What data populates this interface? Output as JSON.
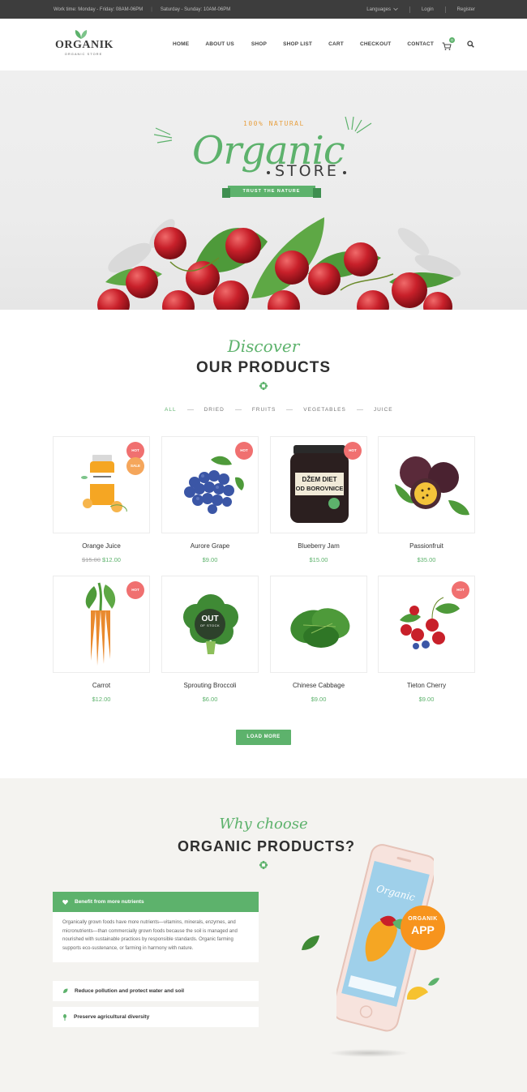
{
  "topbar": {
    "hours_weekday": "Work time: Monday - Friday: 08AM-06PM",
    "hours_weekend": "Saturday - Sunday: 10AM-06PM",
    "languages": "Languages",
    "login": "Login",
    "register": "Register"
  },
  "brand": {
    "name": "ORGANIK",
    "tagline": "ORGANIC STORE"
  },
  "nav": [
    "HOME",
    "ABOUT US",
    "SHOP",
    "SHOP LIST",
    "CART",
    "CHECKOUT",
    "CONTACT"
  ],
  "cart": {
    "count": "0"
  },
  "hero": {
    "natural": "100% NATURAL",
    "organic": "Organic",
    "store": "STORE",
    "ribbon": "TRUST THE NATURE"
  },
  "products": {
    "script": "Discover",
    "title": "OUR PRODUCTS",
    "filters": [
      "ALL",
      "DRIED",
      "FRUITS",
      "VEGETABLES",
      "JUICE"
    ],
    "items": [
      {
        "name": "Orange Juice",
        "old_price": "$15.00",
        "price": "$12.00",
        "badges": [
          "HOT",
          "SALE"
        ]
      },
      {
        "name": "Aurore Grape",
        "old_price": "",
        "price": "$9.00",
        "badges": [
          "HOT"
        ]
      },
      {
        "name": "Blueberry Jam",
        "old_price": "",
        "price": "$15.00",
        "badges": [
          "HOT"
        ]
      },
      {
        "name": "Passionfruit",
        "old_price": "",
        "price": "$35.00",
        "badges": []
      },
      {
        "name": "Carrot",
        "old_price": "",
        "price": "$12.00",
        "badges": [
          "HOT"
        ]
      },
      {
        "name": "Sprouting Broccoli",
        "old_price": "",
        "price": "$6.00",
        "badges": [],
        "out_of_stock": {
          "line1": "OUT",
          "line2": "OF STOCK"
        }
      },
      {
        "name": "Chinese Cabbage",
        "old_price": "",
        "price": "$9.00",
        "badges": []
      },
      {
        "name": "Tieton Cherry",
        "old_price": "",
        "price": "$9.00",
        "badges": [
          "HOT"
        ]
      }
    ],
    "jam_label_1": "DŽEM DIET",
    "jam_label_2": "OD BOROVNICE",
    "load_more": "LOAD MORE"
  },
  "why": {
    "script": "Why choose",
    "title": "ORGANIC PRODUCTS?",
    "items": [
      {
        "title": "Benefit from more nutrients",
        "body": "Organically grown foods have more nutrients—vitamins, minerals, enzymes, and micronutrients—than commercially grown foods because the soil is managed and nourished with sustainable practices by responsible standards. Organic farming supports eco-sustenance, or farming in harmony with nature."
      },
      {
        "title": "Reduce pollution and protect water and soil"
      },
      {
        "title": "Preserve agricultural diversity"
      }
    ],
    "app_badge": {
      "line1": "ORGANIK",
      "line2": "APP"
    },
    "screen_text": "Organic"
  },
  "colors": {
    "accent": "#5db26c",
    "hot": "#f07070",
    "sale": "#f5a65b",
    "app": "#f7941d",
    "topbar": "#3d3d3d"
  }
}
